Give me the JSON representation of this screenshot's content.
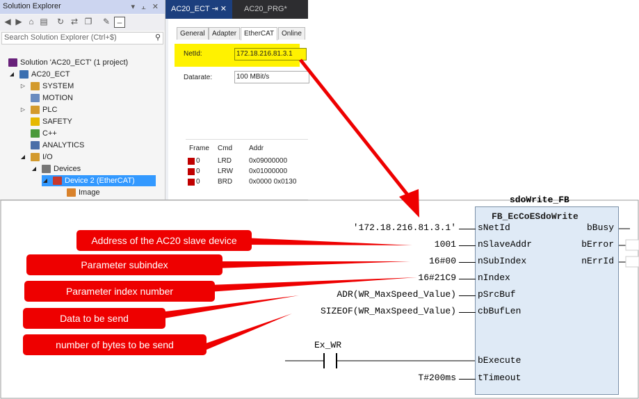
{
  "solution_explorer": {
    "title": "Solution Explorer",
    "title_controls": "▾ ⫠ ✕",
    "search_placeholder": "Search Solution Explorer (Ctrl+$)",
    "items": [
      {
        "label": "Solution 'AC20_ECT' (1 project)",
        "icon": "solution-icon",
        "color": "#68217a"
      },
      {
        "label": "AC20_ECT",
        "icon": "project-icon",
        "color": "#3a6fb0"
      },
      {
        "label": "SYSTEM",
        "icon": "system-icon",
        "color": "#d39a2c"
      },
      {
        "label": "MOTION",
        "icon": "motion-icon",
        "color": "#6a8cbf"
      },
      {
        "label": "PLC",
        "icon": "plc-icon",
        "color": "#d39a2c"
      },
      {
        "label": "SAFETY",
        "icon": "safety-icon",
        "color": "#e6b800"
      },
      {
        "label": "C++",
        "icon": "cpp-icon",
        "color": "#4a9a3a"
      },
      {
        "label": "ANALYTICS",
        "icon": "analytics-icon",
        "color": "#4a6fa8"
      },
      {
        "label": "I/O",
        "icon": "io-icon",
        "color": "#d39a2c"
      },
      {
        "label": "Devices",
        "icon": "devices-icon",
        "color": "#777777"
      },
      {
        "label": "Device 2 (EtherCAT)",
        "icon": "ethercat-device-icon",
        "color": "#c8382c"
      },
      {
        "label": "Image",
        "icon": "image-icon",
        "color": "#d9822b"
      }
    ]
  },
  "device_window": {
    "tab_active": "AC20_ECT  ⇥  ✕",
    "tab_other": "AC20_PRG*",
    "tabs": [
      "General",
      "Adapter",
      "EtherCAT",
      "Online"
    ],
    "netid_label": "NetId:",
    "netid_value": "172.18.216.81.3.1",
    "datarate_label": "Datarate:",
    "datarate_value": "100 MBit/s",
    "grid_headers": [
      "Frame",
      "Cmd",
      "Addr"
    ],
    "grid_rows": [
      {
        "frame": "0",
        "cmd": "LRD",
        "addr": "0x09000000"
      },
      {
        "frame": "0",
        "cmd": "LRW",
        "addr": "0x01000000"
      },
      {
        "frame": "0",
        "cmd": "BRD",
        "addr": "0x0000 0x0130"
      }
    ]
  },
  "fb": {
    "instance": "sdoWrite_FB",
    "type": "FB_EcCoESdoWrite",
    "inputs": [
      {
        "pin": "sNetId",
        "value": "'172.18.216.81.3.1'"
      },
      {
        "pin": "nSlaveAddr",
        "value": "1001"
      },
      {
        "pin": "nSubIndex",
        "value": "16#00"
      },
      {
        "pin": "nIndex",
        "value": "16#21C9"
      },
      {
        "pin": "pSrcBuf",
        "value": "ADR(WR_MaxSpeed_Value)"
      },
      {
        "pin": "cbBufLen",
        "value": "SIZEOF(WR_MaxSpeed_Value)"
      },
      {
        "pin": "bExecute",
        "value": ""
      },
      {
        "pin": "tTimeout",
        "value": "T#200ms"
      }
    ],
    "outputs": [
      "bBusy",
      "bError",
      "nErrId"
    ],
    "contact_label": "Ex_WR"
  },
  "annotations": [
    "Address of the AC20 slave device",
    "Parameter subindex",
    "Parameter index number",
    "Data to be send",
    "number of bytes to be send"
  ],
  "colors": {
    "highlight": "#fff200",
    "arrow": "#ee0000",
    "selection": "#3399ff",
    "fb_fill": "#dfeaf6"
  }
}
